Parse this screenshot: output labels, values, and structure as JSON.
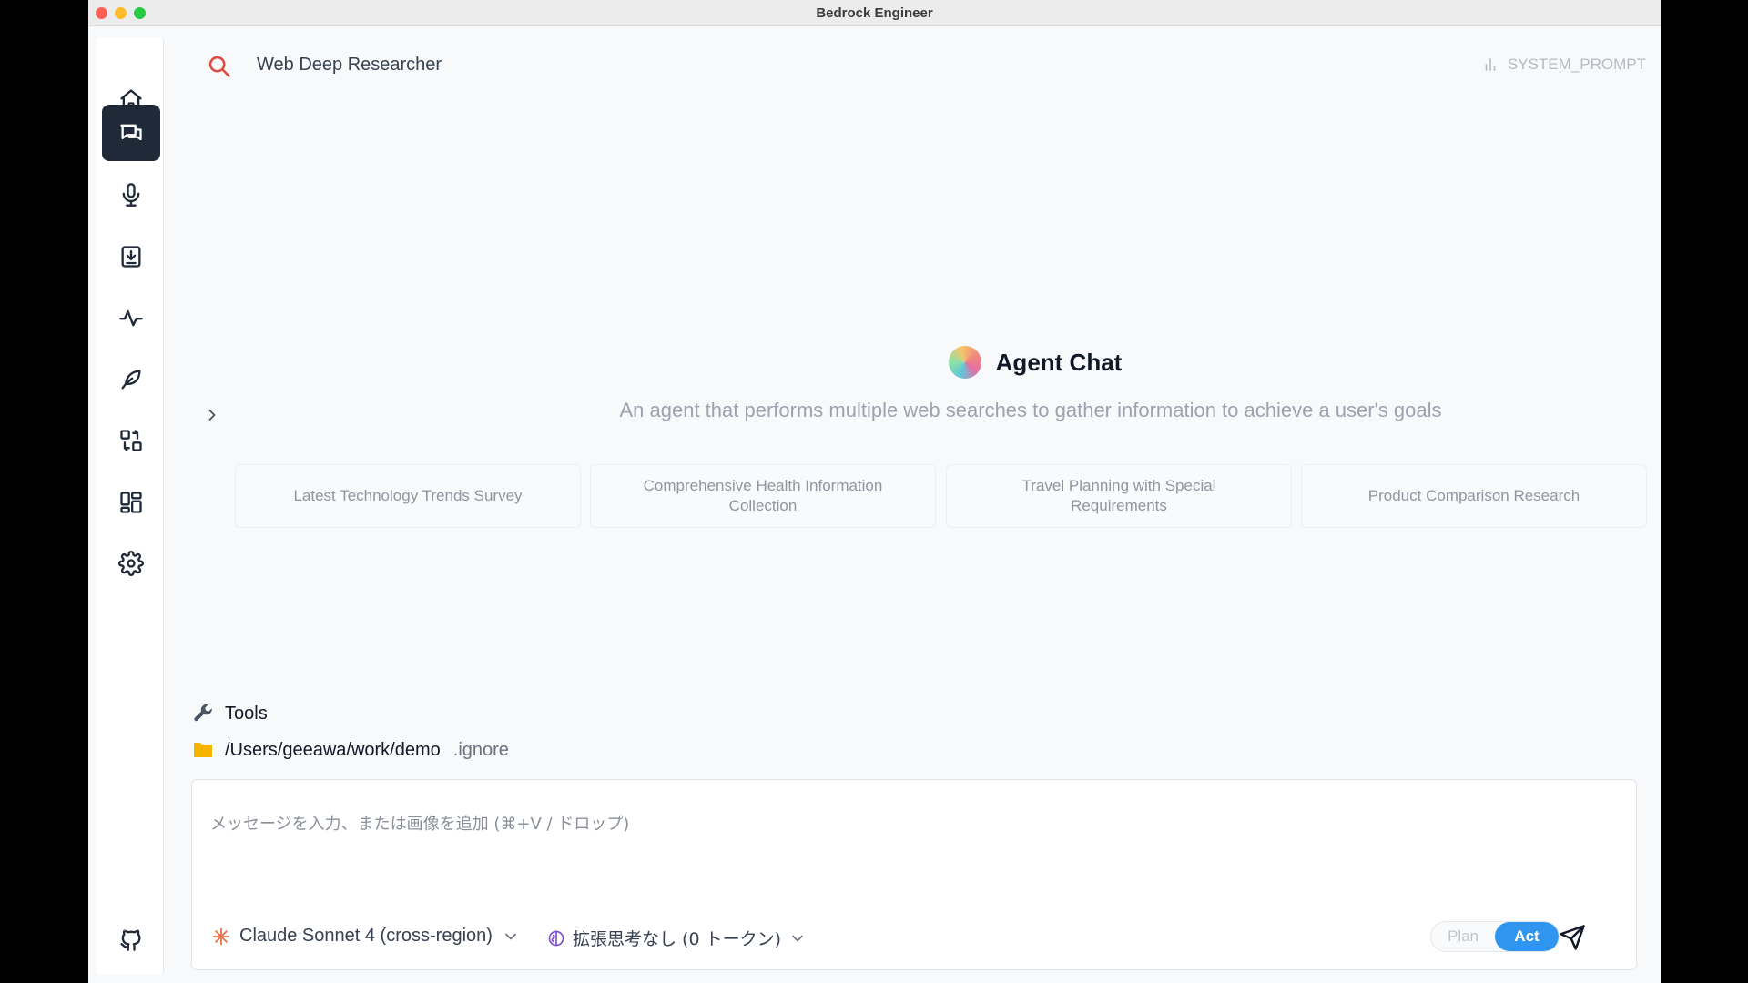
{
  "window": {
    "title": "Bedrock Engineer"
  },
  "sidebar": {
    "items": [
      {
        "name": "home",
        "icon": "home-icon",
        "active": false
      },
      {
        "name": "chat",
        "icon": "chat-icon",
        "active": true
      },
      {
        "name": "voice",
        "icon": "microphone-icon",
        "active": false
      },
      {
        "name": "download",
        "icon": "download-box-icon",
        "active": false
      },
      {
        "name": "activity",
        "icon": "activity-icon",
        "active": false
      },
      {
        "name": "feather",
        "icon": "feather-icon",
        "active": false
      },
      {
        "name": "swap",
        "icon": "swap-icon",
        "active": false
      },
      {
        "name": "dashboard",
        "icon": "dashboard-icon",
        "active": false
      },
      {
        "name": "settings",
        "icon": "gear-icon",
        "active": false
      }
    ],
    "footer_icon": "github-icon"
  },
  "header": {
    "agent_name": "Web Deep Researcher",
    "system_prompt_label": "SYSTEM_PROMPT"
  },
  "hero": {
    "title": "Agent Chat",
    "description": "An agent that performs multiple web searches to gather information to achieve a user's goals"
  },
  "examples": [
    "Latest Technology Trends Survey",
    "Comprehensive Health Information Collection",
    "Travel Planning with Special Requirements",
    "Product Comparison Research"
  ],
  "tools": {
    "label": "Tools"
  },
  "directory": {
    "path": "/Users/geeawa/work/demo",
    "ignore_label": ".ignore"
  },
  "composer": {
    "placeholder": "メッセージを入力、または画像を追加 (⌘+V / ドロップ)",
    "model_label": "Claude Sonnet 4 (cross-region)",
    "thinking_label": "拡張思考なし (0 トークン)",
    "mode_plan": "Plan",
    "mode_act": "Act",
    "active_mode": "Act"
  },
  "colors": {
    "accent": "#2f95ee",
    "sidebar_active": "#1f2937",
    "search_icon": "#e04a3f",
    "folder_icon": "#f5b400",
    "model_icon": "#e8734a",
    "thinking_icon": "#7c4dcf"
  }
}
